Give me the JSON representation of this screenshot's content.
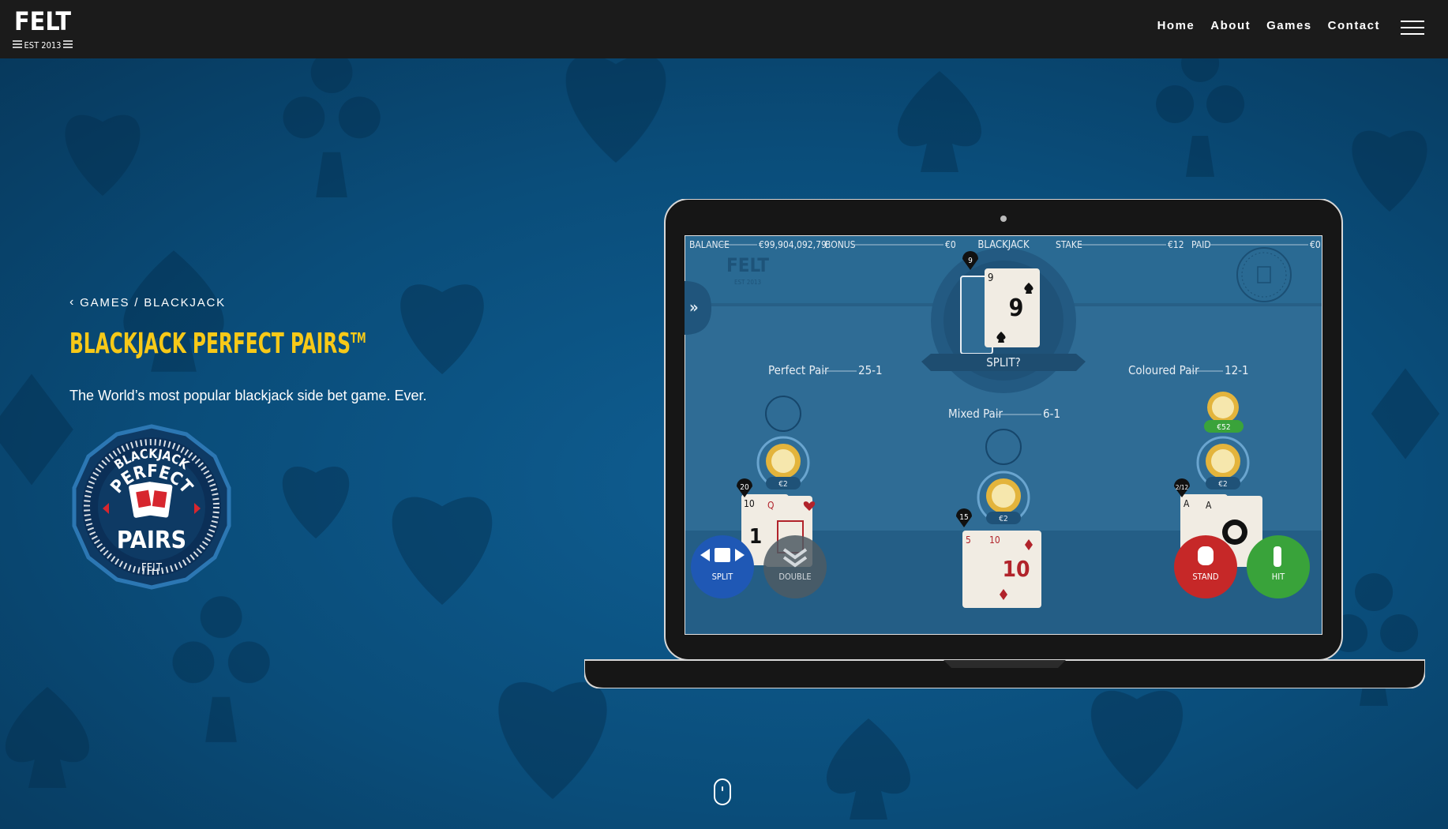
{
  "nav": {
    "logo_text": "FELT",
    "logo_sub": "EST 2013",
    "links": [
      "Home",
      "About",
      "Games",
      "Contact"
    ]
  },
  "hero": {
    "breadcrumb": "GAMES / BLACKJACK",
    "title": "BLACKJACK PERFECT PAIRS",
    "title_sup": "TM",
    "subtitle": "The World’s most popular blackjack side bet game. Ever.",
    "badge": {
      "top": "BLACKJACK",
      "mid": "PERFECT",
      "bottom": "PAIRS",
      "brand": "FELT"
    }
  },
  "game": {
    "balance_label": "BALANCE",
    "balance_value": "€99,904,092,79",
    "bonus_label": "BONUS",
    "bonus_value": "€0",
    "blackjack_label": "BLACKJACK",
    "stake_label": "STAKE",
    "stake_value": "€12",
    "paid_label": "PAID",
    "paid_value": "€0",
    "felt_logo": "FELT",
    "felt_sub": "EST 2013",
    "dealer_count": "9",
    "dealer_card": "9",
    "split_prompt": "SPLIT?",
    "perfect_pair_label": "Perfect Pair",
    "perfect_pair_odds": "25-1",
    "mixed_pair_label": "Mixed Pair",
    "mixed_pair_odds": "6-1",
    "coloured_pair_label": "Coloured Pair",
    "coloured_pair_odds": "12-1",
    "chip_value": "€2",
    "coloured_win": "€52",
    "hand1_count": "20",
    "hand1_cards": [
      "10",
      "Q"
    ],
    "hand1_center": "1",
    "hand2_count": "15",
    "hand2_cards": [
      "5",
      "10"
    ],
    "hand2_center": "10",
    "hand3_count": "2/12",
    "hand3_cards": [
      "A",
      "A"
    ],
    "buttons": {
      "split": "SPLIT",
      "double": "DOUBLE",
      "stand": "STAND",
      "hit": "HIT"
    }
  },
  "colors": {
    "accent": "#f7c918",
    "nav_bg": "#1b1b1b",
    "hero_bg": "#0b4a76",
    "table": "#2f6c95"
  }
}
